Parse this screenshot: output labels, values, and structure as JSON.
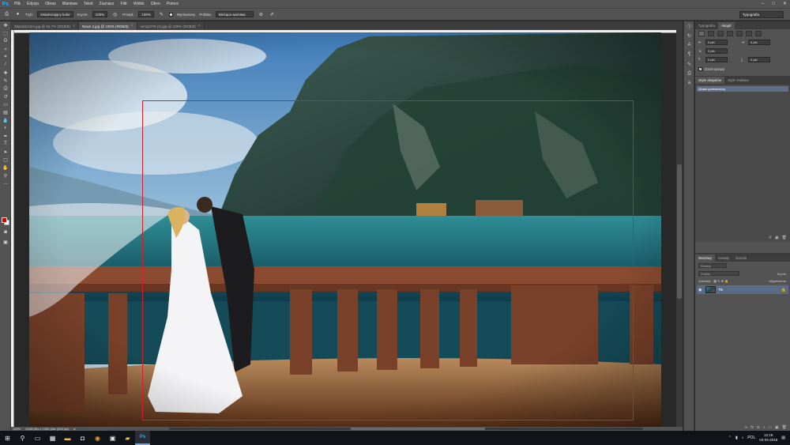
{
  "menubar": {
    "logo": "Ps",
    "items": [
      "Plik",
      "Edycja",
      "Obraz",
      "Warstwa",
      "Tekst",
      "Zaznacz",
      "Filtr",
      "Widok",
      "Okno",
      "Pomoc"
    ]
  },
  "options": {
    "mode_label": "Tryb:",
    "mode_value": "Zwiększający kolor",
    "opacity_label": "Krycie:",
    "opacity_value": "100%",
    "flow_label": "Przepł.:",
    "flow_value": "100%",
    "smoothing_label": "Wyrównany",
    "sample_label": "Próbka:",
    "sample_value": "Bieżąca warstwa",
    "workspace": "Typografia"
  },
  "tabs": [
    {
      "label": "ddandoc12m.jpg @ 66,7% (RGB/8)"
    },
    {
      "label": "Nowe 2.jpg @ 100% (RGB/8)"
    },
    {
      "label": "sempr076 (2).jpg @ 100% (RGB/8)"
    }
  ],
  "status": {
    "zoom": "100%",
    "doc_info": "2048 piks x 1365 piks (300 ppi)"
  },
  "right_panel": {
    "tabs": [
      "Typografia",
      "Akapit"
    ],
    "fields": [
      "0 pkt",
      "0 pkt",
      "0 pkt",
      "0 pkt",
      "0 pkt"
    ],
    "hyphenate": "Dziel wyrazy",
    "styles_tabs": [
      "Style akapitów",
      "Style znaków"
    ],
    "styles_item": "Akapit podstawowy"
  },
  "layers": {
    "tabs": [
      "Warstwy",
      "Kanały",
      "Ścieżki"
    ],
    "kind": "Rodzaj",
    "blend": "Zwykły",
    "opacity_label": "Krycie:",
    "lock_label": "Zablokuj:",
    "fill_label": "Wypełnienie:",
    "layer_name": "Tło"
  },
  "taskbar": {
    "time": "12:18",
    "date": "03-04-2016",
    "lang": "POL"
  },
  "colors": {
    "foreground": "#e00000",
    "background": "#ffffff",
    "selection": "#cc2233"
  }
}
